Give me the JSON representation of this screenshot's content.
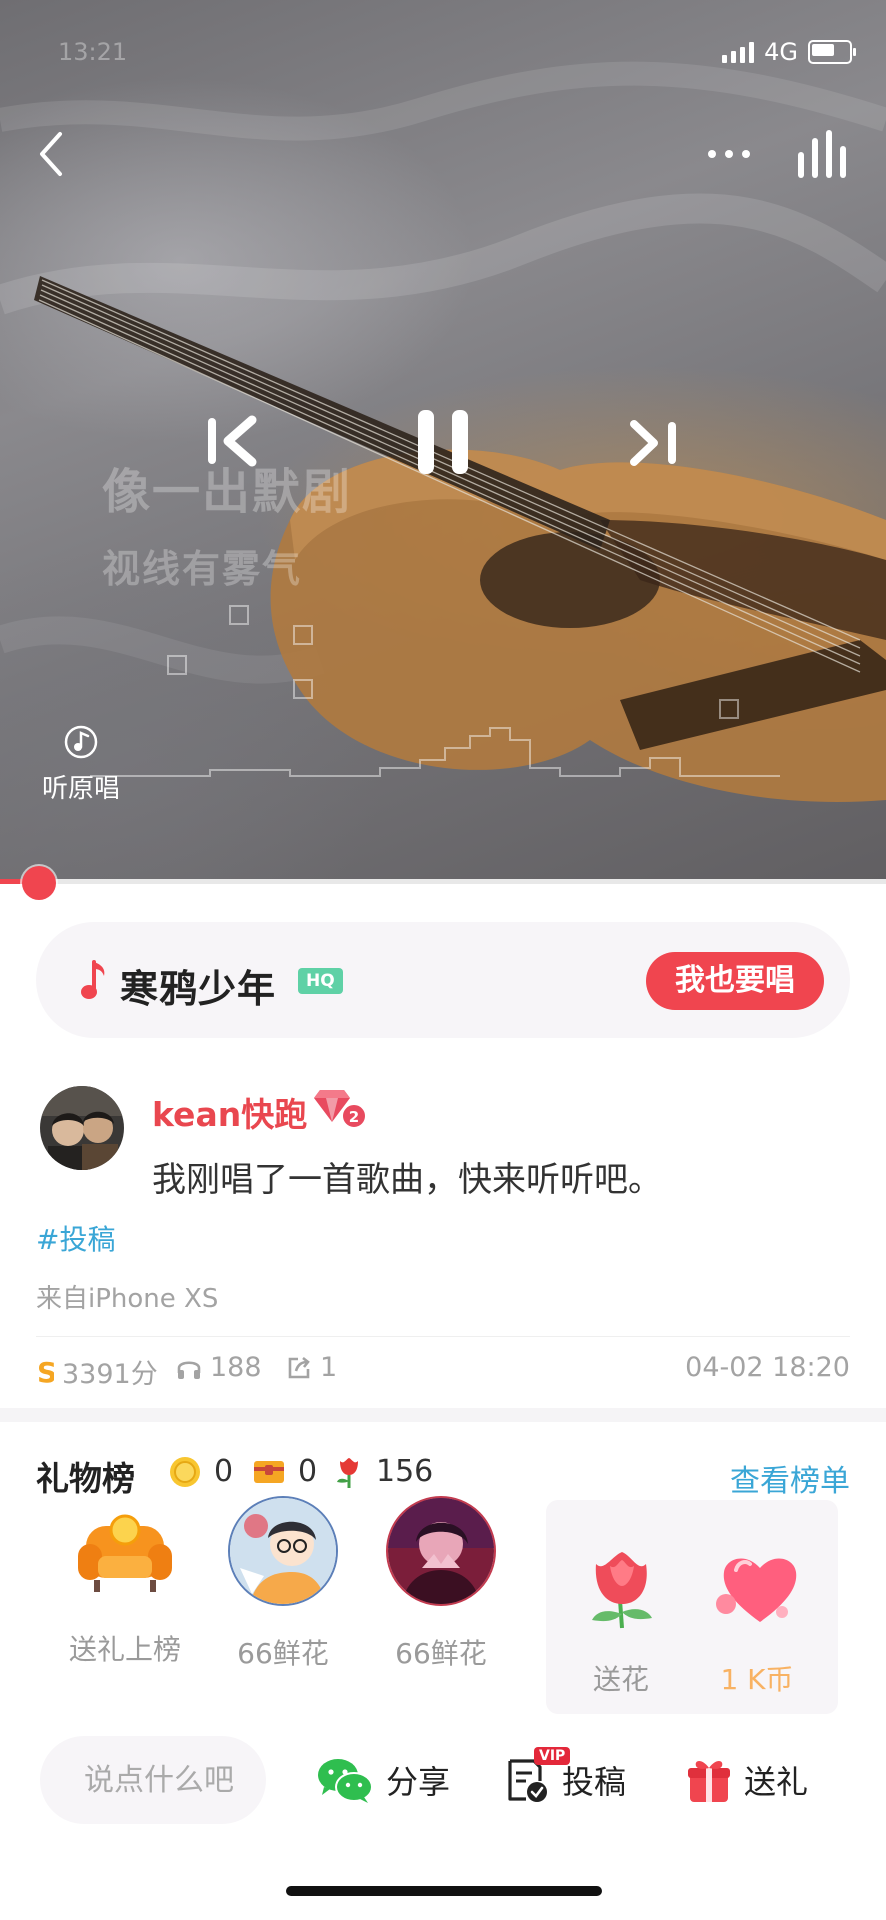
{
  "status_bar": {
    "time": "13:21",
    "network": "4G"
  },
  "player": {
    "lyrics": [
      "像一出默剧",
      "视线有雾气"
    ],
    "original_label": "听原唱",
    "progress": 0.04
  },
  "song": {
    "title": "寒鸦少年",
    "quality_badge": "HQ",
    "sing_button": "我也要唱"
  },
  "post": {
    "username": "kean快跑",
    "text": "我刚唱了一首歌曲，快来听听吧。",
    "hashtag": "#投稿",
    "device": "来自iPhone XS",
    "stats": {
      "score": "3391分",
      "listens": "188",
      "shares": "1",
      "date": "04-02 18:20"
    }
  },
  "gift_board": {
    "title": "礼物榜",
    "coin_count": "0",
    "box_count": "0",
    "flower_count": "156",
    "view_board": "查看榜单",
    "slots": [
      {
        "label": "送礼上榜",
        "icon": "sofa-icon"
      },
      {
        "label": "66鲜花",
        "icon": "avatar"
      },
      {
        "label": "66鲜花",
        "icon": "avatar"
      }
    ],
    "options": [
      {
        "label": "送花",
        "icon": "rose-icon"
      },
      {
        "label": "1 K币",
        "icon": "heart-icon"
      }
    ]
  },
  "bottom_bar": {
    "comment_placeholder": "说点什么吧",
    "share": "分享",
    "submit": "投稿",
    "submit_badge": "VIP",
    "gift": "送礼"
  },
  "colors": {
    "accent": "#f0454f",
    "link": "#3aa6d6",
    "hq": "#5fd1a6",
    "price": "#f8b263"
  }
}
